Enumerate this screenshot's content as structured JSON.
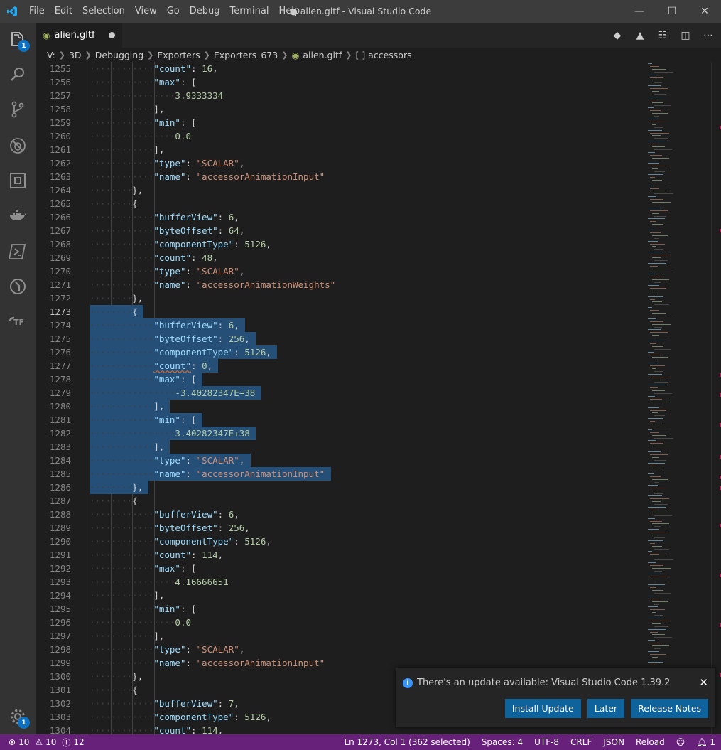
{
  "window": {
    "title": "● alien.gltf - Visual Studio Code",
    "menu": [
      "File",
      "Edit",
      "Selection",
      "View",
      "Go",
      "Debug",
      "Terminal",
      "Help"
    ]
  },
  "activity": {
    "explorer_badge": "1",
    "settings_badge": "1",
    "items": [
      "explorer-icon",
      "search-icon",
      "source-control-icon",
      "debug-icon",
      "extensions-icon",
      "docker-icon",
      "terminal-icon",
      "remote-icon",
      "terraform-icon"
    ]
  },
  "tab": {
    "label": "alien.gltf",
    "dirty": true
  },
  "breadcrumb": [
    "V:",
    "3D",
    "Debugging",
    "Exporters",
    "Exporters_673",
    "alien.gltf",
    "[ ] accessors"
  ],
  "editor": {
    "first_line": 1255,
    "current_line": 1273,
    "lines": [
      {
        "i": 3,
        "t": [
          [
            "k",
            "\"count\""
          ],
          [
            "p",
            ": "
          ],
          [
            "n",
            "16"
          ],
          [
            "p",
            ","
          ]
        ]
      },
      {
        "i": 3,
        "t": [
          [
            "k",
            "\"max\""
          ],
          [
            "p",
            ": ["
          ]
        ]
      },
      {
        "i": 4,
        "t": [
          [
            "n",
            "3.9333334"
          ]
        ]
      },
      {
        "i": 3,
        "t": [
          [
            "p",
            "],"
          ]
        ]
      },
      {
        "i": 3,
        "t": [
          [
            "k",
            "\"min\""
          ],
          [
            "p",
            ": ["
          ]
        ]
      },
      {
        "i": 4,
        "t": [
          [
            "n",
            "0.0"
          ]
        ]
      },
      {
        "i": 3,
        "t": [
          [
            "p",
            "],"
          ]
        ]
      },
      {
        "i": 3,
        "t": [
          [
            "k",
            "\"type\""
          ],
          [
            "p",
            ": "
          ],
          [
            "s",
            "\"SCALAR\""
          ],
          [
            "p",
            ","
          ]
        ]
      },
      {
        "i": 3,
        "t": [
          [
            "k",
            "\"name\""
          ],
          [
            "p",
            ": "
          ],
          [
            "s",
            "\"accessorAnimationInput\""
          ]
        ]
      },
      {
        "i": 2,
        "t": [
          [
            "p",
            "},"
          ]
        ]
      },
      {
        "i": 2,
        "t": [
          [
            "p",
            "{"
          ]
        ]
      },
      {
        "i": 3,
        "t": [
          [
            "k",
            "\"bufferView\""
          ],
          [
            "p",
            ": "
          ],
          [
            "n",
            "6"
          ],
          [
            "p",
            ","
          ]
        ]
      },
      {
        "i": 3,
        "t": [
          [
            "k",
            "\"byteOffset\""
          ],
          [
            "p",
            ": "
          ],
          [
            "n",
            "64"
          ],
          [
            "p",
            ","
          ]
        ]
      },
      {
        "i": 3,
        "t": [
          [
            "k",
            "\"componentType\""
          ],
          [
            "p",
            ": "
          ],
          [
            "n",
            "5126"
          ],
          [
            "p",
            ","
          ]
        ]
      },
      {
        "i": 3,
        "t": [
          [
            "k",
            "\"count\""
          ],
          [
            "p",
            ": "
          ],
          [
            "n",
            "48"
          ],
          [
            "p",
            ","
          ]
        ]
      },
      {
        "i": 3,
        "t": [
          [
            "k",
            "\"type\""
          ],
          [
            "p",
            ": "
          ],
          [
            "s",
            "\"SCALAR\""
          ],
          [
            "p",
            ","
          ]
        ]
      },
      {
        "i": 3,
        "t": [
          [
            "k",
            "\"name\""
          ],
          [
            "p",
            ": "
          ],
          [
            "s",
            "\"accessorAnimationWeights\""
          ]
        ]
      },
      {
        "i": 2,
        "t": [
          [
            "p",
            "},"
          ]
        ]
      },
      {
        "i": 2,
        "sel": true,
        "t": [
          [
            "p",
            "{"
          ]
        ]
      },
      {
        "i": 3,
        "sel": true,
        "t": [
          [
            "k",
            "\"bufferView\""
          ],
          [
            "p",
            ": "
          ],
          [
            "n",
            "6"
          ],
          [
            "p",
            ","
          ]
        ]
      },
      {
        "i": 3,
        "sel": true,
        "t": [
          [
            "k",
            "\"byteOffset\""
          ],
          [
            "p",
            ": "
          ],
          [
            "n",
            "256"
          ],
          [
            "p",
            ","
          ]
        ]
      },
      {
        "i": 3,
        "sel": true,
        "t": [
          [
            "k",
            "\"componentType\""
          ],
          [
            "p",
            ": "
          ],
          [
            "n",
            "5126"
          ],
          [
            "p",
            ","
          ]
        ]
      },
      {
        "i": 3,
        "sel": true,
        "warn": true,
        "t": [
          [
            "k",
            "\"count\""
          ],
          [
            "p",
            ": "
          ],
          [
            "n",
            "0"
          ],
          [
            "p",
            ","
          ]
        ]
      },
      {
        "i": 3,
        "sel": true,
        "t": [
          [
            "k",
            "\"max\""
          ],
          [
            "p",
            ": ["
          ]
        ]
      },
      {
        "i": 4,
        "sel": true,
        "t": [
          [
            "n",
            "-3.40282347E+38"
          ]
        ]
      },
      {
        "i": 3,
        "sel": true,
        "t": [
          [
            "p",
            "],"
          ]
        ]
      },
      {
        "i": 3,
        "sel": true,
        "t": [
          [
            "k",
            "\"min\""
          ],
          [
            "p",
            ": ["
          ]
        ]
      },
      {
        "i": 4,
        "sel": true,
        "t": [
          [
            "n",
            "3.40282347E+38"
          ]
        ]
      },
      {
        "i": 3,
        "sel": true,
        "t": [
          [
            "p",
            "],"
          ]
        ]
      },
      {
        "i": 3,
        "sel": true,
        "t": [
          [
            "k",
            "\"type\""
          ],
          [
            "p",
            ": "
          ],
          [
            "s",
            "\"SCALAR\""
          ],
          [
            "p",
            ","
          ]
        ]
      },
      {
        "i": 3,
        "sel": true,
        "t": [
          [
            "k",
            "\"name\""
          ],
          [
            "p",
            ": "
          ],
          [
            "s",
            "\"accessorAnimationInput\""
          ]
        ]
      },
      {
        "i": 2,
        "sel": true,
        "t": [
          [
            "p",
            "},"
          ]
        ]
      },
      {
        "i": 2,
        "t": [
          [
            "p",
            "{"
          ]
        ]
      },
      {
        "i": 3,
        "t": [
          [
            "k",
            "\"bufferView\""
          ],
          [
            "p",
            ": "
          ],
          [
            "n",
            "6"
          ],
          [
            "p",
            ","
          ]
        ]
      },
      {
        "i": 3,
        "t": [
          [
            "k",
            "\"byteOffset\""
          ],
          [
            "p",
            ": "
          ],
          [
            "n",
            "256"
          ],
          [
            "p",
            ","
          ]
        ]
      },
      {
        "i": 3,
        "t": [
          [
            "k",
            "\"componentType\""
          ],
          [
            "p",
            ": "
          ],
          [
            "n",
            "5126"
          ],
          [
            "p",
            ","
          ]
        ]
      },
      {
        "i": 3,
        "t": [
          [
            "k",
            "\"count\""
          ],
          [
            "p",
            ": "
          ],
          [
            "n",
            "114"
          ],
          [
            "p",
            ","
          ]
        ]
      },
      {
        "i": 3,
        "t": [
          [
            "k",
            "\"max\""
          ],
          [
            "p",
            ": ["
          ]
        ]
      },
      {
        "i": 4,
        "t": [
          [
            "n",
            "4.16666651"
          ]
        ]
      },
      {
        "i": 3,
        "t": [
          [
            "p",
            "],"
          ]
        ]
      },
      {
        "i": 3,
        "t": [
          [
            "k",
            "\"min\""
          ],
          [
            "p",
            ": ["
          ]
        ]
      },
      {
        "i": 4,
        "t": [
          [
            "n",
            "0.0"
          ]
        ]
      },
      {
        "i": 3,
        "t": [
          [
            "p",
            "],"
          ]
        ]
      },
      {
        "i": 3,
        "t": [
          [
            "k",
            "\"type\""
          ],
          [
            "p",
            ": "
          ],
          [
            "s",
            "\"SCALAR\""
          ],
          [
            "p",
            ","
          ]
        ]
      },
      {
        "i": 3,
        "t": [
          [
            "k",
            "\"name\""
          ],
          [
            "p",
            ": "
          ],
          [
            "s",
            "\"accessorAnimationInput\""
          ]
        ]
      },
      {
        "i": 2,
        "t": [
          [
            "p",
            "},"
          ]
        ]
      },
      {
        "i": 2,
        "t": [
          [
            "p",
            "{"
          ]
        ]
      },
      {
        "i": 3,
        "t": [
          [
            "k",
            "\"bufferView\""
          ],
          [
            "p",
            ": "
          ],
          [
            "n",
            "7"
          ],
          [
            "p",
            ","
          ]
        ]
      },
      {
        "i": 3,
        "t": [
          [
            "k",
            "\"componentType\""
          ],
          [
            "p",
            ": "
          ],
          [
            "n",
            "5126"
          ],
          [
            "p",
            ","
          ]
        ]
      },
      {
        "i": 3,
        "t": [
          [
            "k",
            "\"count\""
          ],
          [
            "p",
            ": "
          ],
          [
            "n",
            "114"
          ],
          [
            "p",
            ","
          ]
        ]
      }
    ]
  },
  "notification": {
    "message": "There's an update available: Visual Studio Code 1.39.2",
    "buttons": [
      "Install Update",
      "Later",
      "Release Notes"
    ]
  },
  "statusbar": {
    "errors": "10",
    "warnings": "10",
    "infos": "12",
    "position": "Ln 1273, Col 1 (362 selected)",
    "spaces": "Spaces: 4",
    "encoding": "UTF-8",
    "eol": "CRLF",
    "language": "JSON",
    "reload": "Reload",
    "notifications": "1"
  },
  "colors": {
    "statusbar": "#68217a",
    "selection": "#264f78",
    "key": "#9cdcfe",
    "string": "#ce9178",
    "number": "#b5cea8",
    "button": "#0e639c"
  }
}
